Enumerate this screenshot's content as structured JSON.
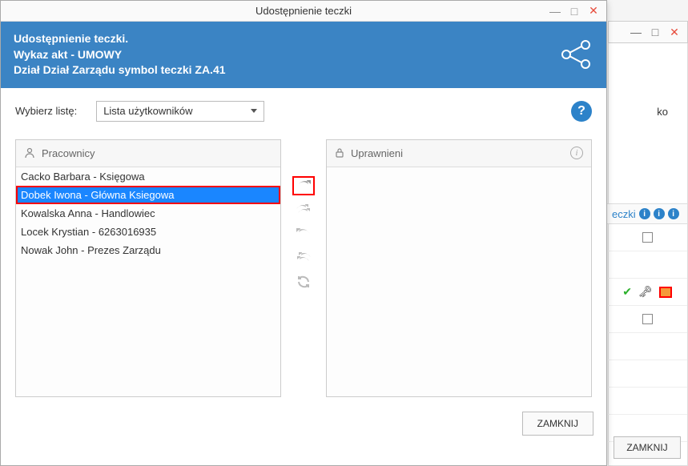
{
  "titlebar": {
    "title": "Udostępnienie teczki"
  },
  "header": {
    "line1": "Udostępnienie teczki.",
    "line2": "Wykaz akt - UMOWY",
    "line3": "Dział Dział Zarządu symbol teczki ZA.41"
  },
  "selectRow": {
    "label": "Wybierz listę:",
    "selected": "Lista użytkowników",
    "help": "?"
  },
  "leftPanel": {
    "title": "Pracownicy"
  },
  "rightPanel": {
    "title": "Uprawnieni"
  },
  "employees": {
    "e0": "Cacko Barbara - Księgowa",
    "e1": "Dobek Iwona - Główna Ksiegowa",
    "e2": "Kowalska Anna - Handlowiec",
    "e3": "Locek Krystian - 6263016935",
    "e4": "Nowak John - Prezes Zarządu"
  },
  "buttons": {
    "close": "ZAMKNIJ"
  },
  "bg": {
    "ko": "ko",
    "colHdr": "eczki",
    "close": "ZAMKNIJ"
  }
}
